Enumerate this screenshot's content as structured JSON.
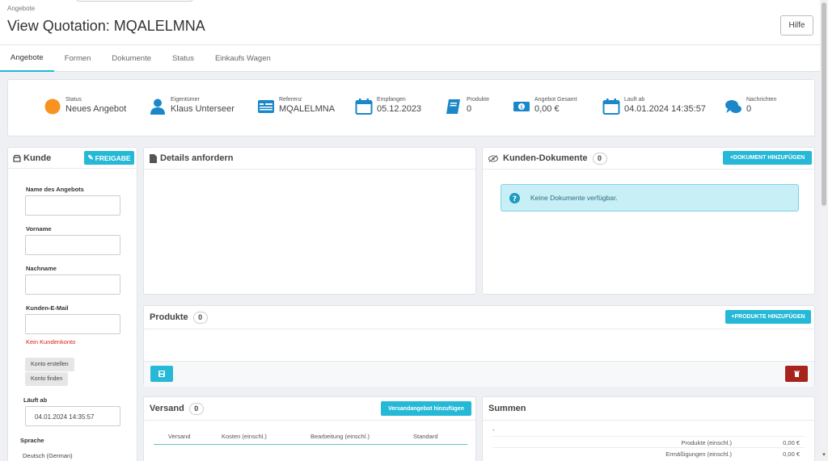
{
  "breadcrumb": "Angebote",
  "page_title": "View Quotation: MQALELMNA",
  "help_label": "Hilfe",
  "tabs": [
    "Angebote",
    "Formen",
    "Dokumente",
    "Status",
    "Einkaufs Wagen"
  ],
  "kpis": [
    {
      "label": "Status",
      "value": "Neues Angebot",
      "icon": "status-dot-icon",
      "color": "#f7931e"
    },
    {
      "label": "Eigentümer",
      "value": "Klaus Unterseer",
      "icon": "user-icon"
    },
    {
      "label": "Referenz",
      "value": "MQALELMNA",
      "icon": "id-card-icon"
    },
    {
      "label": "Empfangen",
      "value": "05.12.2023",
      "icon": "calendar-icon"
    },
    {
      "label": "Produkte",
      "value": "0",
      "icon": "book-icon"
    },
    {
      "label": "Angebot Gesamt",
      "value": "0,00 €",
      "icon": "money-icon"
    },
    {
      "label": "Lauft ab",
      "value": "04.01.2024 14:35:57",
      "icon": "calendar-icon"
    },
    {
      "label": "Nachrichten",
      "value": "0",
      "icon": "comments-icon"
    }
  ],
  "customer": {
    "title": "Kunde",
    "share_label": "FREIGABE",
    "name_label": "Name des Angebots",
    "firstname_label": "Vorname",
    "lastname_label": "Nachname",
    "email_label": "Kunden-E-Mail",
    "no_account": "Kein Kundenkonto",
    "create_account": "Konto erstellen",
    "find_account": "Konto finden",
    "expires_label": "Läuft ab",
    "expires_value": "04.01.2024 14:35:57",
    "language_label": "Sprache",
    "language_value": "Deutsch (German)"
  },
  "details": {
    "title": "Details anfordern"
  },
  "documents": {
    "title": "Kunden-Dokumente",
    "count": "0",
    "add_label": "DOKUMENT HINZUFÜGEN",
    "empty": "Keine Dokumente verfügbar."
  },
  "products": {
    "title": "Produkte",
    "count": "0",
    "add_label": "PRODUKTE HINZUFÜGEN"
  },
  "shipping": {
    "title": "Versand",
    "count": "0",
    "add_label": "Versandangebot hinzufügen",
    "columns": [
      "Versand",
      "Kosten (einschl.)",
      "Bearbeitung (einschl.)",
      "Standard"
    ]
  },
  "totals": {
    "title": "Summen",
    "dash": "-",
    "rows": [
      {
        "label": "Produkte (einschl.)",
        "value": "0,00 €"
      },
      {
        "label": "Ermäßigungen (einschl.)",
        "value": "0,00 €"
      }
    ]
  },
  "colors": {
    "accent": "#25b9d7",
    "danger": "#a9231d",
    "alert_bg": "#c8eef6",
    "error_text": "#e0201c"
  }
}
